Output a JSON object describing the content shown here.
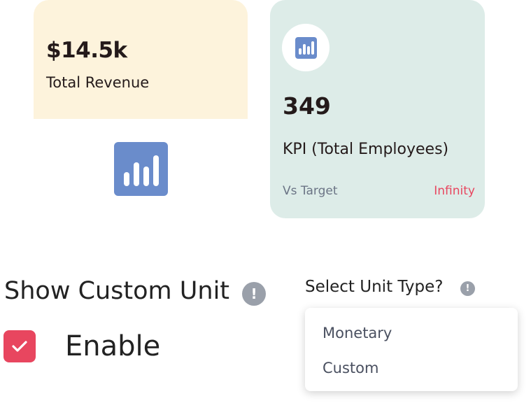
{
  "revenue_card": {
    "value": "$14.5k",
    "label": "Total Revenue",
    "icon": "bar-chart-icon",
    "background": "#fdf3dc"
  },
  "kpi_card": {
    "icon": "bar-chart-icon",
    "value": "349",
    "label": "KPI (Total Employees)",
    "comparison_label": "Vs Target",
    "comparison_value": "Infinity",
    "background": "#ddece8",
    "accent": "#e8465f"
  },
  "custom_unit": {
    "title": "Show Custom Unit",
    "info_icon": "!",
    "checkbox_checked": true,
    "checkbox_label": "Enable",
    "checkbox_color": "#e8465f"
  },
  "unit_type": {
    "title": "Select Unit Type?",
    "info_icon": "!",
    "options": [
      "Monetary",
      "Custom"
    ]
  },
  "colors": {
    "icon_blue": "#6a8ccb"
  }
}
